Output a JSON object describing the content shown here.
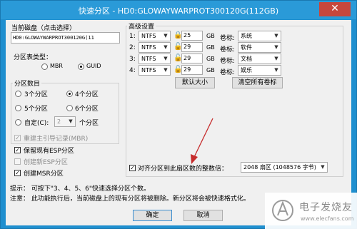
{
  "window": {
    "title": "快速分区 - HD0:GLOWAYWARPROT300120G(112GB)",
    "close": "✕"
  },
  "disk": {
    "group_label": "当前磁盘（点击选择）",
    "value": "HD0:GLOWAYWARPROT300120G(11"
  },
  "ptable": {
    "label": "分区表类型：",
    "mbr": "MBR",
    "guid": "GUID"
  },
  "count": {
    "group_label": "分区数目",
    "opt3": "3个分区",
    "opt4": "4个分区",
    "opt5": "5个分区",
    "opt6": "6个分区",
    "custom": "自定(C):",
    "custom_value": "2",
    "custom_suffix": "个分区"
  },
  "checks": {
    "rebuild_mbr": "重建主引导记录(MBR)",
    "keep_esp": "保留现有ESP分区",
    "create_esp": "创建新ESP分区",
    "create_msr": "创建MSR分区",
    "check": "✓"
  },
  "advanced": {
    "group_label": "高级设置",
    "volume_label": "卷标:",
    "unit": "GB",
    "rows": [
      {
        "num": "1:",
        "fs": "NTFS",
        "size": "25",
        "label": "系统"
      },
      {
        "num": "2:",
        "fs": "NTFS",
        "size": "29",
        "label": "软件"
      },
      {
        "num": "3:",
        "fs": "NTFS",
        "size": "29",
        "label": "文档"
      },
      {
        "num": "4:",
        "fs": "NTFS",
        "size": "29",
        "label": "娱乐"
      }
    ],
    "default_size": "默认大小",
    "clear_labels": "清空所有卷标",
    "align_label": "对齐分区到此扇区数的整数倍：",
    "align_value": "2048 扇区 (1048576 字节)"
  },
  "hints": {
    "tip": "提示：   可按下\"3、4、5、6\"快速选择分区个数。",
    "note": "注意：   此功能执行后，当前磁盘上的现有分区将被删除。新分区将会被快速格式化。"
  },
  "buttons": {
    "ok": "确定",
    "cancel": "取消"
  },
  "watermark": {
    "text": "电子发烧友",
    "url": "www.elecfans.com"
  },
  "colors": {
    "titlebar": "#2a9ad8",
    "close": "#c7473c",
    "arrow": "#c62b2b"
  }
}
